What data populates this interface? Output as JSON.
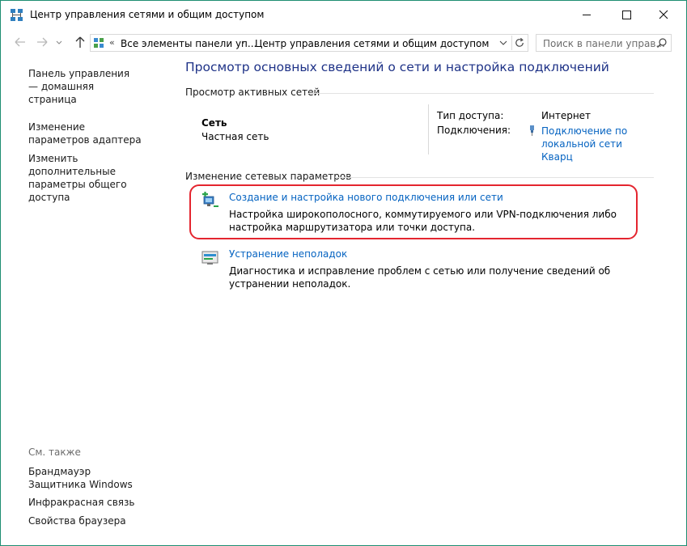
{
  "window": {
    "title": "Центр управления сетями и общим доступом",
    "accent_color": "#1e8e72"
  },
  "address": {
    "separator": "«",
    "crumb1": "Все элементы панели уп...",
    "chevron": "›",
    "crumb2": "Центр управления сетями и общим доступом"
  },
  "search": {
    "placeholder": "Поиск в панели управ..."
  },
  "left_pane": {
    "home_link": "Панель управления — домашняя страница",
    "adapter_link": "Изменение параметров адаптера",
    "sharing_link": "Изменить дополнительные параметры общего доступа"
  },
  "see_also": {
    "header": "См. также",
    "items": [
      "Брандмауэр Защитника Windows",
      "Инфракрасная связь",
      "Свойства браузера"
    ]
  },
  "main": {
    "title": "Просмотр основных сведений о сети и настройка подключений",
    "active_header": "Просмотр активных сетей",
    "network": {
      "name": "Сеть",
      "type": "Частная сеть",
      "access_label": "Тип доступа:",
      "access_value": "Интернет",
      "connections_label": "Подключения:",
      "connection_link": "Подключение по локальной сети Кварц"
    },
    "change_header": "Изменение сетевых параметров",
    "tasks": [
      {
        "icon": "new-connection-icon",
        "link": "Создание и настройка нового подключения или сети",
        "desc": "Настройка широкополосного, коммутируемого или VPN-подключения либо настройка маршрутизатора или точки доступа."
      },
      {
        "icon": "troubleshoot-icon",
        "link": "Устранение неполадок",
        "desc": "Диагностика и исправление проблем с сетью или получение сведений об устранении неполадок."
      }
    ],
    "highlight_color": "#e4252f",
    "link_color": "#0563c1",
    "title_color": "#1e3287"
  }
}
